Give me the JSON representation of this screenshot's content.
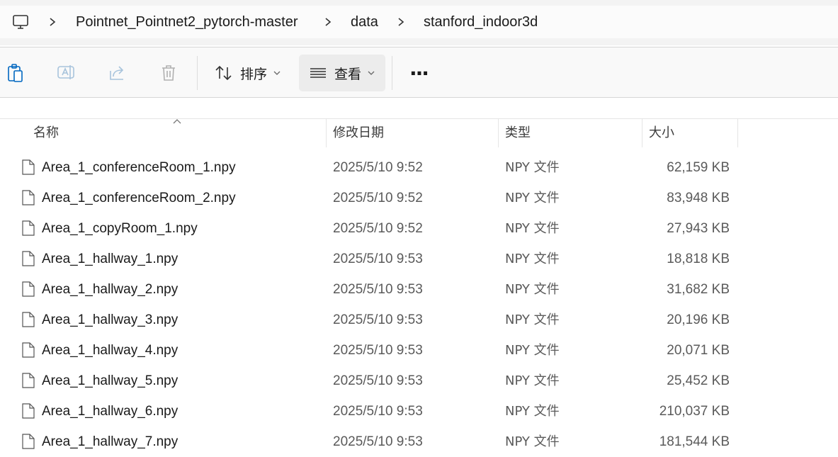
{
  "breadcrumb": {
    "items": [
      "Pointnet_Pointnet2_pytorch-master",
      "data",
      "stanford_indoor3d"
    ]
  },
  "toolbar": {
    "sort_label": "排序",
    "view_label": "查看",
    "more_label": "···"
  },
  "columns": {
    "name": "名称",
    "date": "修改日期",
    "type": "类型",
    "size": "大小"
  },
  "files": [
    {
      "name": "Area_1_conferenceRoom_1.npy",
      "date": "2025/5/10 9:52",
      "type": "NPY 文件",
      "size": "62,159 KB"
    },
    {
      "name": "Area_1_conferenceRoom_2.npy",
      "date": "2025/5/10 9:52",
      "type": "NPY 文件",
      "size": "83,948 KB"
    },
    {
      "name": "Area_1_copyRoom_1.npy",
      "date": "2025/5/10 9:52",
      "type": "NPY 文件",
      "size": "27,943 KB"
    },
    {
      "name": "Area_1_hallway_1.npy",
      "date": "2025/5/10 9:53",
      "type": "NPY 文件",
      "size": "18,818 KB"
    },
    {
      "name": "Area_1_hallway_2.npy",
      "date": "2025/5/10 9:53",
      "type": "NPY 文件",
      "size": "31,682 KB"
    },
    {
      "name": "Area_1_hallway_3.npy",
      "date": "2025/5/10 9:53",
      "type": "NPY 文件",
      "size": "20,196 KB"
    },
    {
      "name": "Area_1_hallway_4.npy",
      "date": "2025/5/10 9:53",
      "type": "NPY 文件",
      "size": "20,071 KB"
    },
    {
      "name": "Area_1_hallway_5.npy",
      "date": "2025/5/10 9:53",
      "type": "NPY 文件",
      "size": "25,452 KB"
    },
    {
      "name": "Area_1_hallway_6.npy",
      "date": "2025/5/10 9:53",
      "type": "NPY 文件",
      "size": "210,037 KB"
    },
    {
      "name": "Area_1_hallway_7.npy",
      "date": "2025/5/10 9:53",
      "type": "NPY 文件",
      "size": "181,544 KB"
    }
  ],
  "icons": {
    "computer": "computer-icon",
    "paste": "paste-icon",
    "rename": "rename-icon",
    "share": "share-icon",
    "delete": "delete-icon",
    "sort": "sort-icon",
    "view": "view-icon",
    "file": "file-icon"
  },
  "colors": {
    "accent": "#0067c0",
    "disabled": "#a8a8a8"
  }
}
